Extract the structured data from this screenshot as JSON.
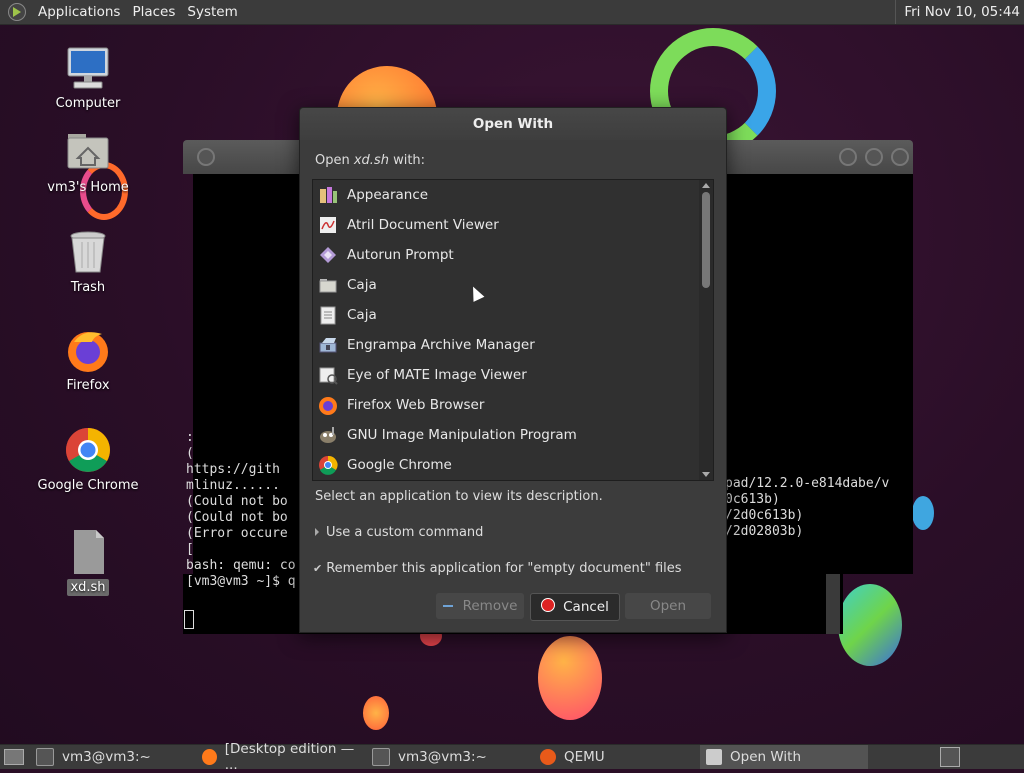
{
  "top_panel": {
    "menus": [
      "Applications",
      "Places",
      "System"
    ],
    "clock": "Fri Nov 10, 05:44"
  },
  "desktop_icons": [
    {
      "label": "Computer",
      "icon": "computer-icon"
    },
    {
      "label": "vm3's Home",
      "icon": "home-folder-icon"
    },
    {
      "label": "Trash",
      "icon": "trash-icon"
    },
    {
      "label": "Firefox",
      "icon": "firefox-icon"
    },
    {
      "label": "Google Chrome",
      "icon": "chrome-icon"
    },
    {
      "label": "xd.sh",
      "icon": "file-icon"
    }
  ],
  "terminal": {
    "left_lines": [
      ":",
      "(",
      "https://gith",
      "mlinuz......",
      "(Could not bo",
      "(Could not bo",
      "(Error occure",
      "["
    ],
    "right_lines": [
      "pad/12.2.0-e814dabe/v",
      "0c613b)",
      "/2d0c613b)",
      "/2d02803b)"
    ],
    "prompt_lines": [
      "bash: qemu: co",
      "[vm3@vm3 ~]$ q"
    ]
  },
  "dialog": {
    "title": "Open With",
    "prompt_prefix": "Open ",
    "prompt_file": "xd.sh",
    "prompt_suffix": " with:",
    "apps": [
      {
        "name": "Appearance",
        "icon": "appearance-icon"
      },
      {
        "name": "Atril Document Viewer",
        "icon": "atril-icon"
      },
      {
        "name": "Autorun Prompt",
        "icon": "autorun-icon"
      },
      {
        "name": "Caja",
        "icon": "caja-folder-icon"
      },
      {
        "name": "Caja",
        "icon": "caja-file-icon"
      },
      {
        "name": "Engrampa Archive Manager",
        "icon": "engrampa-icon"
      },
      {
        "name": "Eye of MATE Image Viewer",
        "icon": "eom-icon"
      },
      {
        "name": "Firefox Web Browser",
        "icon": "firefox-icon"
      },
      {
        "name": "GNU Image Manipulation Program",
        "icon": "gimp-icon"
      },
      {
        "name": "Google Chrome",
        "icon": "chrome-icon"
      }
    ],
    "description": "Select an application to view its description.",
    "custom_command": "Use a custom command",
    "remember_label": "Remember this application for \"empty document\" files",
    "buttons": {
      "remove": "Remove",
      "cancel": "Cancel",
      "open": "Open"
    }
  },
  "taskbar": {
    "tasks": [
      {
        "label": "vm3@vm3:~",
        "icon": "terminal-icon"
      },
      {
        "label": "[Desktop edition — ...",
        "icon": "firefox-icon"
      },
      {
        "label": "vm3@vm3:~",
        "icon": "terminal-icon"
      },
      {
        "label": "QEMU",
        "icon": "qemu-icon"
      },
      {
        "label": "Open With",
        "icon": "dialog-icon"
      }
    ]
  },
  "colors": {
    "accent_cancel": "#d22222",
    "panel": "#3b3b3b",
    "dialog": "#3c3c3c"
  }
}
